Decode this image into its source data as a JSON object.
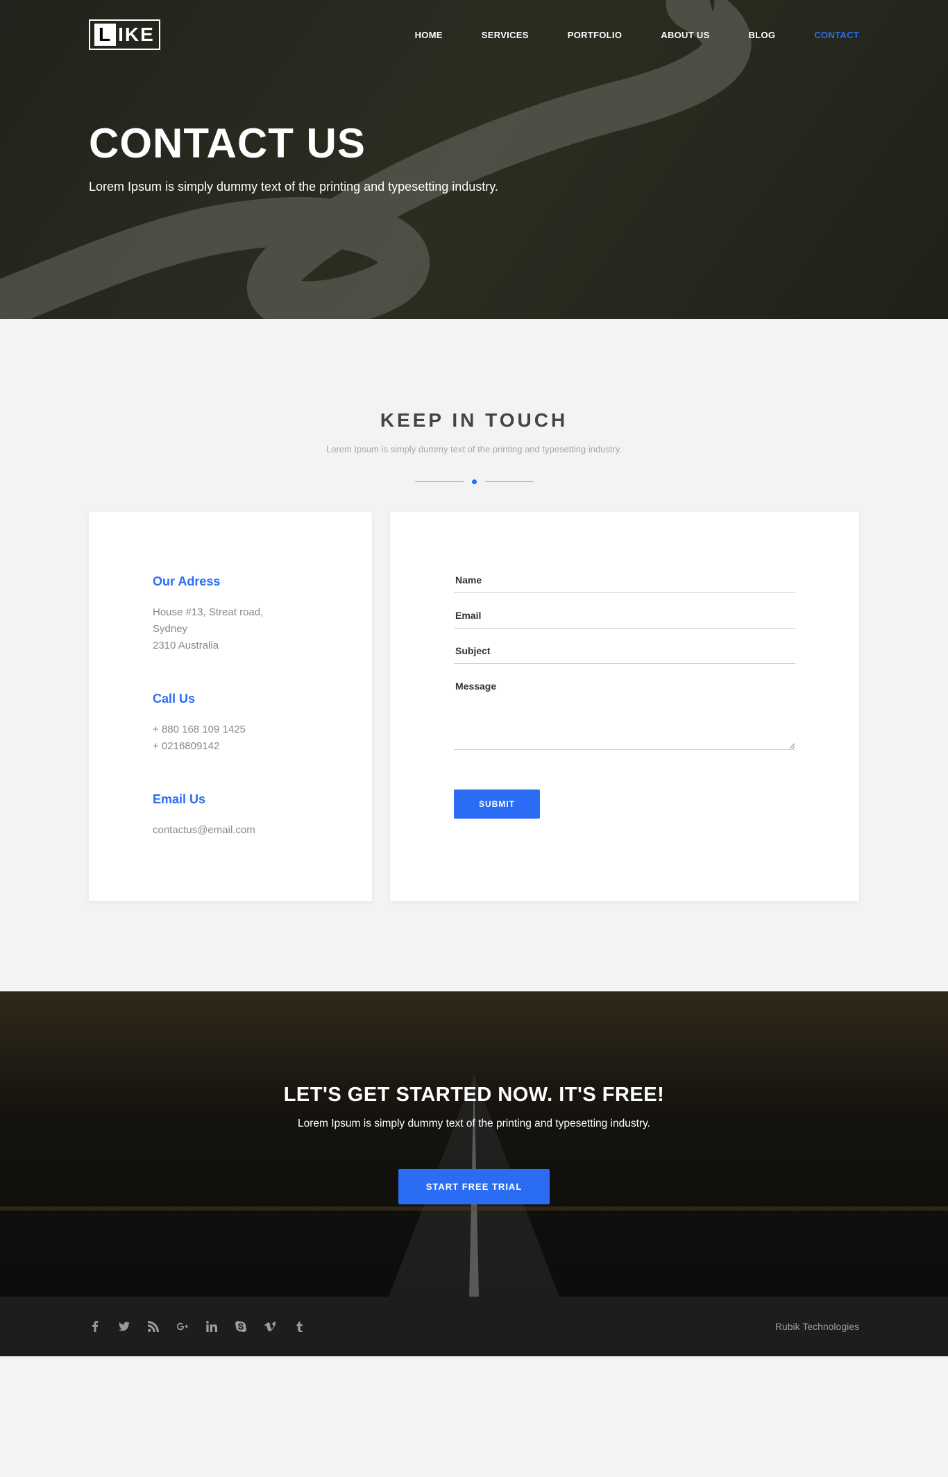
{
  "logo": {
    "left": "L",
    "right": "IKE"
  },
  "nav": [
    {
      "label": "HOME",
      "active": false
    },
    {
      "label": "SERVICES",
      "active": false
    },
    {
      "label": "PORTFOLIO",
      "active": false
    },
    {
      "label": "ABOUT US",
      "active": false
    },
    {
      "label": "BLOG",
      "active": false
    },
    {
      "label": "CONTACT",
      "active": true
    }
  ],
  "hero": {
    "title": "CONTACT US",
    "subtitle": "Lorem Ipsum is simply dummy text of the printing and typesetting industry."
  },
  "section": {
    "title": "KEEP IN TOUCH",
    "subtitle": "Lorem Ipsum is simply dummy text of the printing and typesetting industry."
  },
  "address": {
    "title": "Our Adress",
    "line1": "House #13, Streat road,",
    "line2": "Sydney",
    "line3": "2310 Australia"
  },
  "call": {
    "title": "Call Us",
    "line1": "+ 880 168 109 1425",
    "line2": "+ 0216809142"
  },
  "email": {
    "title": "Email Us",
    "line1": "contactus@email.com"
  },
  "form": {
    "name": "Name",
    "email": "Email",
    "subject": "Subject",
    "message": "Message",
    "submit": "SUBMIT"
  },
  "cta": {
    "title": "LET'S GET STARTED NOW. IT'S FREE!",
    "subtitle": "Lorem Ipsum is simply dummy text of the printing and typesetting industry.",
    "button": "START FREE TRIAL"
  },
  "footer": {
    "company": "Rubik Technologies",
    "icons": [
      "facebook-icon",
      "twitter-icon",
      "rss-icon",
      "googleplus-icon",
      "linkedin-icon",
      "skype-icon",
      "vimeo-icon",
      "tumblr-icon"
    ]
  }
}
